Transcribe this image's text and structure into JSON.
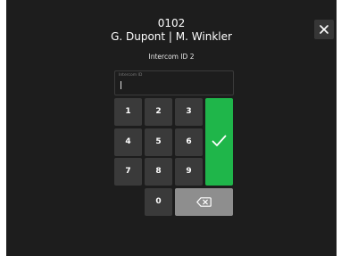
{
  "header": {
    "apartment_number": "0102",
    "residents": "G. Dupont | M. Winkler",
    "intercom_heading": "Intercom ID 2"
  },
  "input": {
    "label": "Intercom ID",
    "value": ""
  },
  "keypad": {
    "key_1": "1",
    "key_2": "2",
    "key_3": "3",
    "key_4": "4",
    "key_5": "5",
    "key_6": "6",
    "key_7": "7",
    "key_8": "8",
    "key_9": "9",
    "key_0": "0"
  },
  "icons": {
    "close": "close-icon",
    "confirm": "checkmark-icon",
    "backspace": "backspace-icon"
  },
  "colors": {
    "background": "#1d1d1d",
    "key": "#3a3a3a",
    "confirm": "#1fb64a",
    "backspace": "#8e8e8e",
    "text": "#ffffff"
  }
}
